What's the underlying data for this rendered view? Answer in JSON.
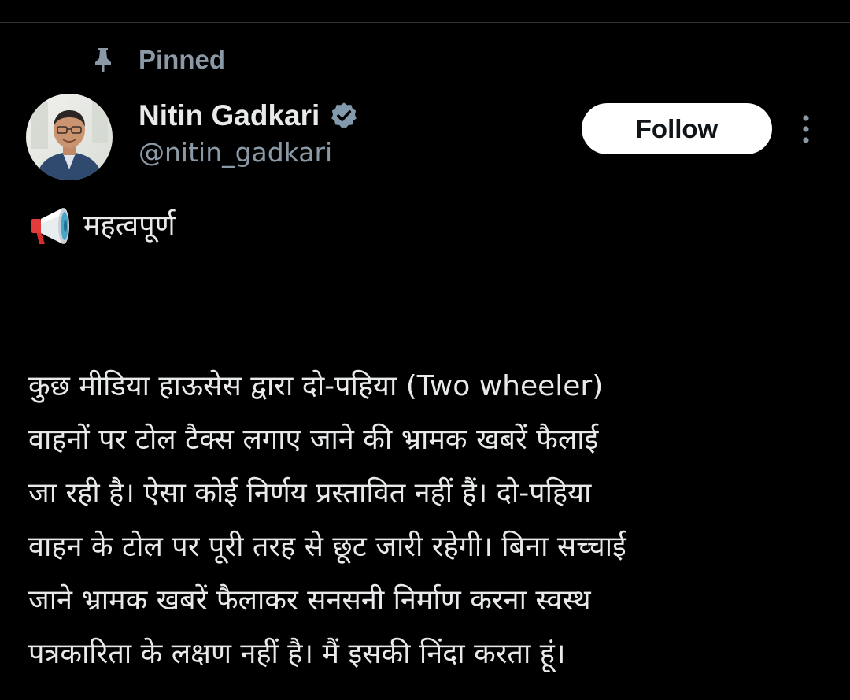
{
  "pinned": {
    "label": "Pinned",
    "icon": "pin-icon"
  },
  "author": {
    "display_name": "Nitin Gadkari",
    "handle": "@nitin_gadkari",
    "verified": true,
    "verified_icon": "verified-badge-icon",
    "avatar_icon": "avatar"
  },
  "actions": {
    "follow_label": "Follow",
    "more_icon": "more-options-icon"
  },
  "tweet": {
    "headline_icon": "megaphone-icon",
    "headline": "महत्वपूर्ण",
    "lines": [
      "कुछ मीडिया हाऊसेस  द्वारा दो-पहिया (Two wheeler)",
      "वाहनों पर टोल टैक्स लगाए जाने की भ्रामक खबरें फैलाई",
      "जा रही है। ऐसा कोई निर्णय प्रस्तावित नहीं हैं। दो-पहिया",
      "वाहन के टोल पर पूरी तरह से छूट जारी रहेगी। बिना सच्चाई",
      "जाने भ्रामक खबरें फैलाकर सनसनी निर्माण करना स्वस्थ",
      "पत्रकारिता के लक्षण नहीं है। मैं इसकी निंदा करता हूं।"
    ]
  },
  "colors": {
    "background": "#000000",
    "primary_text": "#e7e9ea",
    "secondary_text": "#8b98a5",
    "follow_bg": "#ffffff",
    "follow_text": "#0f1419",
    "verified_badge": "#829aab",
    "divider": "#2f3336"
  }
}
